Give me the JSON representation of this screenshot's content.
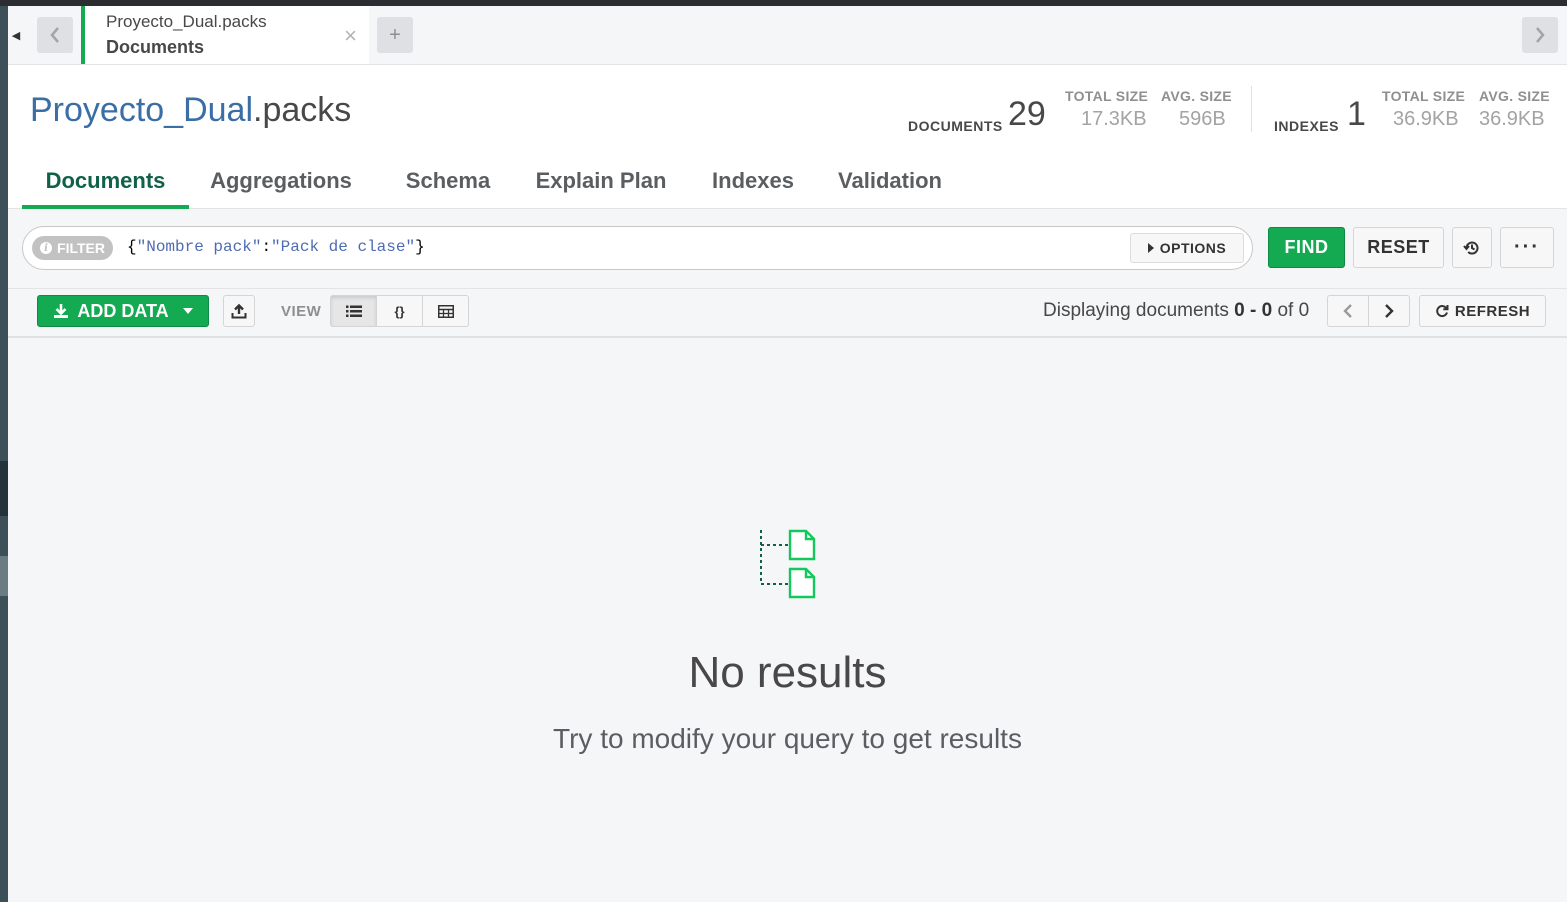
{
  "tab": {
    "title": "Proyecto_Dual.packs",
    "subtitle": "Documents"
  },
  "header": {
    "database": "Proyecto_Dual",
    "collection": ".packs"
  },
  "stats": {
    "documents_label": "DOCUMENTS",
    "documents_count": "29",
    "docs_total_size_label": "TOTAL SIZE",
    "docs_total_size": "17.3KB",
    "docs_avg_size_label": "AVG. SIZE",
    "docs_avg_size": "596B",
    "indexes_label": "INDEXES",
    "indexes_count": "1",
    "idx_total_size_label": "TOTAL SIZE",
    "idx_total_size": "36.9KB",
    "idx_avg_size_label": "AVG. SIZE",
    "idx_avg_size": "36.9KB"
  },
  "tabs": [
    {
      "label": "Documents",
      "active": true
    },
    {
      "label": "Aggregations"
    },
    {
      "label": "Schema"
    },
    {
      "label": "Explain Plan"
    },
    {
      "label": "Indexes"
    },
    {
      "label": "Validation"
    }
  ],
  "query": {
    "filter_label": "FILTER",
    "filter_key": "\"Nombre pack\"",
    "filter_value": "\"Pack de clase\"",
    "options_label": "OPTIONS",
    "find_label": "FIND",
    "reset_label": "RESET",
    "more_label": "···"
  },
  "toolbar": {
    "add_data_label": "ADD DATA",
    "view_label": "VIEW",
    "displaying_prefix": "Displaying documents",
    "range": "0 - 0",
    "of_text": "of 0",
    "refresh_label": "REFRESH"
  },
  "empty_state": {
    "title": "No results",
    "hint": "Try to modify your query to get results"
  },
  "colors": {
    "accent": "#13aa52",
    "active_tab_text": "#116149",
    "db_name": "#3a6ea5"
  }
}
